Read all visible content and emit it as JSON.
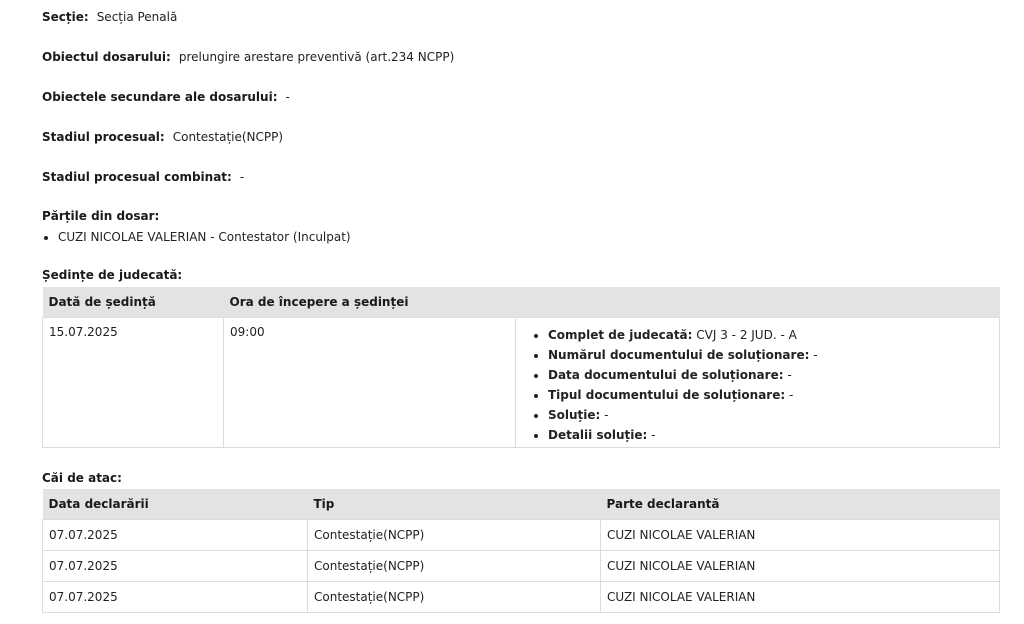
{
  "case": {
    "section_label": "Secție:",
    "section_value": "Secția Penală",
    "object_label": "Obiectul dosarului:",
    "object_value": "prelungire arestare preventivă (art.234 NCPP)",
    "secondary_label": "Obiectele secundare ale dosarului:",
    "secondary_value": "-",
    "stage_label": "Stadiul procesual:",
    "stage_value": "Contestație(NCPP)",
    "combined_label": "Stadiul procesual combinat:",
    "combined_value": "-"
  },
  "parties": {
    "heading": "Părțile din dosar:",
    "items": [
      "CUZI NICOLAE VALERIAN - Contestator (Inculpat)"
    ]
  },
  "hearings": {
    "heading": "Ședințe de judecată:",
    "columns": [
      "Dată de ședință",
      "Ora de începere a ședinței",
      ""
    ],
    "rows": [
      {
        "date": "15.07.2025",
        "time": "09:00",
        "details": [
          {
            "label": "Complet de judecată:",
            "value": "CVJ 3 - 2 JUD. - A"
          },
          {
            "label": "Numărul documentului de soluționare:",
            "value": "-"
          },
          {
            "label": "Data documentului de soluționare:",
            "value": "-"
          },
          {
            "label": "Tipul documentului de soluționare:",
            "value": "-"
          },
          {
            "label": "Soluție:",
            "value": "-"
          },
          {
            "label": "Detalii soluție:",
            "value": "-"
          }
        ]
      }
    ]
  },
  "appeals": {
    "heading": "Căi de atac:",
    "columns": [
      "Data declarării",
      "Tip",
      "Parte declarantă"
    ],
    "rows": [
      [
        "07.07.2025",
        "Contestație(NCPP)",
        "CUZI NICOLAE VALERIAN"
      ],
      [
        "07.07.2025",
        "Contestație(NCPP)",
        "CUZI NICOLAE VALERIAN"
      ],
      [
        "07.07.2025",
        "Contestație(NCPP)",
        "CUZI NICOLAE VALERIAN"
      ]
    ]
  }
}
